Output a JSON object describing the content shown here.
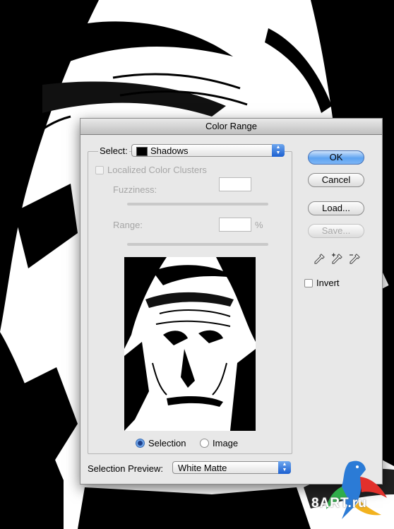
{
  "window": {
    "title": "Color Range"
  },
  "select": {
    "label": "Select:",
    "value": "Shadows",
    "swatch_color": "#000000"
  },
  "localized_clusters": {
    "label": "Localized Color Clusters",
    "checked": false,
    "enabled": false
  },
  "fuzziness": {
    "label": "Fuzziness:",
    "value": ""
  },
  "range": {
    "label": "Range:",
    "value": "",
    "unit": "%"
  },
  "buttons": {
    "ok": "OK",
    "cancel": "Cancel",
    "load": "Load...",
    "save": "Save..."
  },
  "invert": {
    "label": "Invert",
    "checked": false
  },
  "preview_mode": {
    "selection": "Selection",
    "image": "Image",
    "selected": "Selection"
  },
  "selection_preview": {
    "label": "Selection Preview:",
    "value": "White Matte"
  },
  "icons": [
    "eyedropper-icon",
    "eyedropper-plus-icon",
    "eyedropper-minus-icon",
    "select-arrows-icon"
  ],
  "watermark": {
    "text": "8ART.ru"
  },
  "colors": {
    "accent": "#3b82e8",
    "dialog_bg": "#e8e8e8",
    "disabled_text": "#a6a6a6"
  }
}
